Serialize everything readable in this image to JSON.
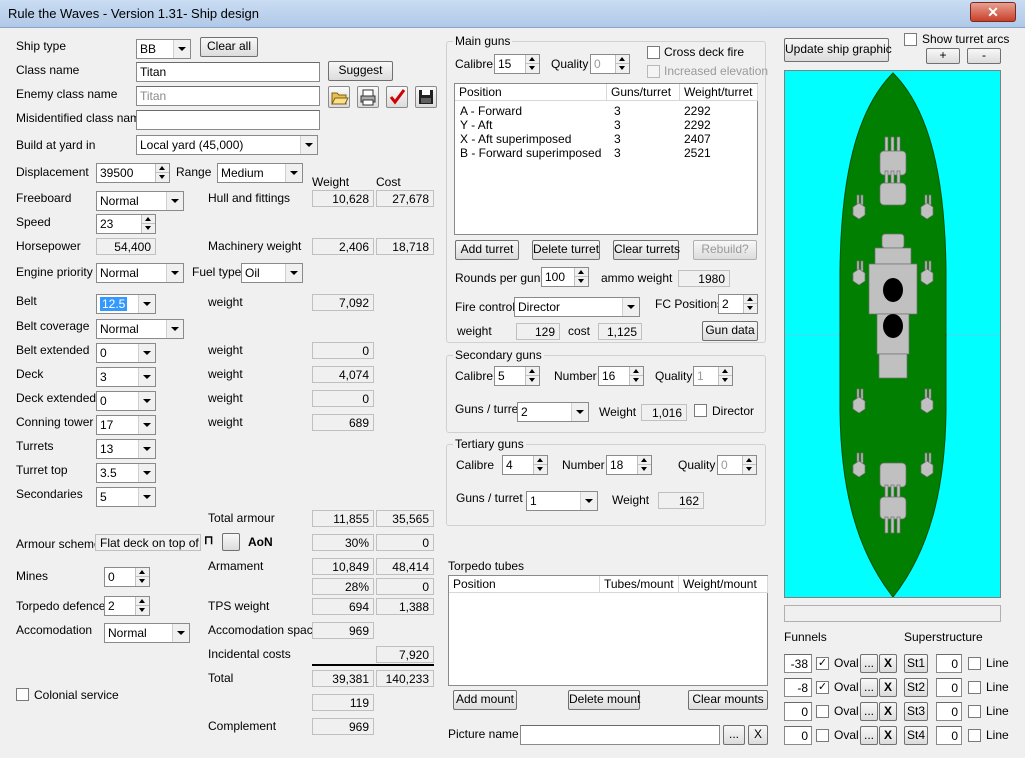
{
  "window": {
    "title": "Rule the Waves - Version 1.31- Ship design"
  },
  "left": {
    "ship_type_label": "Ship type",
    "ship_type": "BB",
    "clear_all": "Clear all",
    "class_name_label": "Class name",
    "class_name": "Titan",
    "suggest": "Suggest",
    "enemy_class_label": "Enemy class name",
    "enemy_class": "Titan",
    "misid_label": "Misidentified class name",
    "misid": "",
    "yard_label": "Build at yard in",
    "yard": "Local yard (45,000)",
    "displacement_label": "Displacement",
    "displacement": "39500",
    "range_label": "Range",
    "range": "Medium",
    "weight_hdr": "Weight",
    "cost_hdr": "Cost",
    "freeboard_label": "Freeboard",
    "freeboard": "Normal",
    "hull_label": "Hull and fittings",
    "hull_weight": "10,628",
    "hull_cost": "27,678",
    "speed_label": "Speed",
    "speed": "23",
    "hp_label": "Horsepower",
    "hp": "54,400",
    "mach_label": "Machinery weight",
    "mach_weight": "2,406",
    "mach_cost": "18,718",
    "engine_label": "Engine priority",
    "engine": "Normal",
    "fuel_label": "Fuel type",
    "fuel": "Oil",
    "belt_label": "Belt",
    "belt": "12.5",
    "belt_weight_label": "weight",
    "belt_weight": "7,092",
    "belt_cov_label": "Belt coverage",
    "belt_cov": "Normal",
    "belt_ext_label": "Belt extended",
    "belt_ext": "0",
    "belt_ext_weight_label": "weight",
    "belt_ext_weight": "0",
    "deck_label": "Deck",
    "deck": "3",
    "deck_weight_label": "weight",
    "deck_weight": "4,074",
    "deck_ext_label": "Deck extended",
    "deck_ext": "0",
    "deck_ext_weight_label": "weight",
    "deck_ext_weight": "0",
    "ct_label": "Conning tower",
    "ct": "17",
    "ct_weight_label": "weight",
    "ct_weight": "689",
    "turrets_label": "Turrets",
    "turrets": "13",
    "turret_top_label": "Turret top",
    "turret_top": "3.5",
    "secondaries_label": "Secondaries",
    "secondaries": "5",
    "total_armour_label": "Total armour",
    "total_armour_weight": "11,855",
    "total_armour_cost": "35,565",
    "armour_scheme_label": "Armour scheme",
    "armour_scheme": "Flat deck on top of",
    "aon": "AoN",
    "armour_pct": "30%",
    "armour_pct_cost": "0",
    "mines_label": "Mines",
    "mines": "0",
    "armament_label": "Armament",
    "armament_weight": "10,849",
    "armament_cost": "48,414",
    "arm_pct": "28%",
    "arm_pct_cost": "0",
    "torp_def_label": "Torpedo defence",
    "torp_def": "2",
    "tps_label": "TPS weight",
    "tps_weight": "694",
    "tps_cost": "1,388",
    "accom_label": "Accomodation",
    "accom": "Normal",
    "accom_space_label": "Accomodation space",
    "accom_space": "969",
    "incidental_label": "Incidental costs",
    "incidental_cost": "7,920",
    "total_label": "Total",
    "total_weight": "39,381",
    "total_cost": "140,233",
    "extra_val": "119",
    "colonial_label": "Colonial service",
    "complement_label": "Complement",
    "complement": "969"
  },
  "main_guns": {
    "title": "Main guns",
    "calibre_label": "Calibre",
    "calibre": "15",
    "quality_label": "Quality",
    "quality": "0",
    "cross_deck": "Cross deck fire",
    "inc_elev": "Increased elevation",
    "headers": [
      "Position",
      "Guns/turret",
      "Weight/turret"
    ],
    "rows": [
      {
        "pos": "A - Forward",
        "guns": "3",
        "weight": "2292"
      },
      {
        "pos": "Y - Aft",
        "guns": "3",
        "weight": "2292"
      },
      {
        "pos": "X - Aft superimposed",
        "guns": "3",
        "weight": "2407"
      },
      {
        "pos": "B - Forward superimposed",
        "guns": "3",
        "weight": "2521"
      }
    ],
    "add_turret": "Add turret",
    "delete_turret": "Delete turret",
    "clear_turrets": "Clear turrets",
    "rebuild": "Rebuild?",
    "rounds_label": "Rounds per gun",
    "rounds": "100",
    "ammo_label": "ammo weight",
    "ammo": "1980",
    "fire_control_label": "Fire control",
    "fire_control": "Director",
    "fc_pos_label": "FC Positions",
    "fc_pos": "2",
    "weight_label": "weight",
    "weight": "129",
    "cost_label": "cost",
    "cost": "1,125",
    "gun_data": "Gun data"
  },
  "secondary": {
    "title": "Secondary guns",
    "calibre_label": "Calibre",
    "calibre": "5",
    "number_label": "Number",
    "number": "16",
    "quality_label": "Quality",
    "quality": "1",
    "gpt_label": "Guns / turret",
    "gpt": "2",
    "weight_label": "Weight",
    "weight": "1,016",
    "director": "Director"
  },
  "tertiary": {
    "title": "Tertiary guns",
    "calibre_label": "Calibre",
    "calibre": "4",
    "number_label": "Number",
    "number": "18",
    "quality_label": "Quality",
    "quality": "0",
    "gpt_label": "Guns / turret",
    "gpt": "1",
    "weight_label": "Weight",
    "weight": "162"
  },
  "torpedo": {
    "title": "Torpedo tubes",
    "headers": [
      "Position",
      "Tubes/mount",
      "Weight/mount"
    ],
    "add": "Add mount",
    "delete": "Delete mount",
    "clear": "Clear mounts"
  },
  "picture": {
    "label": "Picture name",
    "value": "",
    "browse": "...",
    "clear": "X"
  },
  "graphic": {
    "update": "Update ship graphic",
    "show_arcs": "Show turret arcs",
    "plus": "+",
    "minus": "-",
    "funnels_label": "Funnels",
    "super_label": "Superstructure",
    "funnels": [
      {
        "pos": "-38",
        "oval": true,
        "oval_label": "Oval",
        "more": "...",
        "x": "X",
        "st": "St1",
        "st_val": "0",
        "line_label": "Line"
      },
      {
        "pos": "-8",
        "oval": true,
        "oval_label": "Oval",
        "more": "...",
        "x": "X",
        "st": "St2",
        "st_val": "0",
        "line_label": "Line"
      },
      {
        "pos": "0",
        "oval": false,
        "oval_label": "Oval",
        "more": "...",
        "x": "X",
        "st": "St3",
        "st_val": "0",
        "line_label": "Line"
      },
      {
        "pos": "0",
        "oval": false,
        "oval_label": "Oval",
        "more": "...",
        "x": "X",
        "st": "St4",
        "st_val": "0",
        "line_label": "Line"
      }
    ],
    "colors": {
      "sea": "#00ffff",
      "hull": "#007f00",
      "structure": "#c0c0c0",
      "funnel": "#000000"
    }
  }
}
